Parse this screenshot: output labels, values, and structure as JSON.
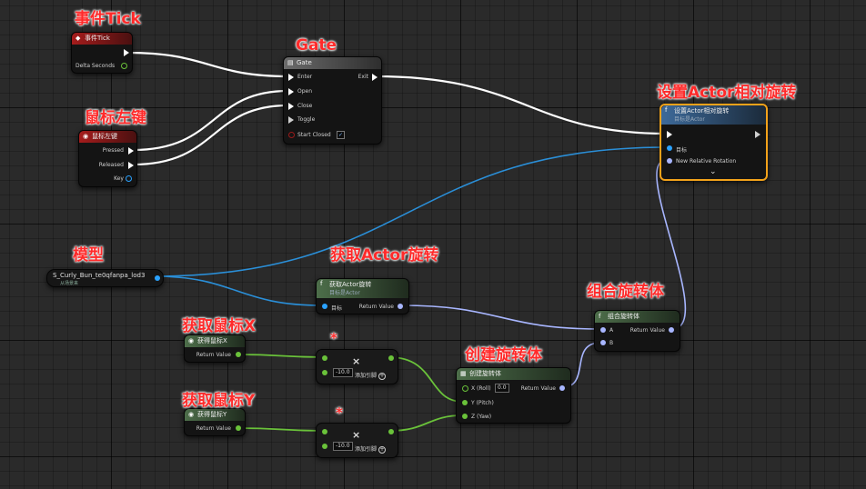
{
  "annotations": {
    "event_tick": "事件Tick",
    "gate": "Gate",
    "mouse_left": "鼠标左键",
    "set_rotation": "设置Actor相对旋转",
    "model": "模型",
    "get_rotation": "获取Actor旋转",
    "combine": "组合旋转体",
    "get_mouse_x": "获取鼠标X",
    "get_mouse_y": "获取鼠标Y",
    "make_rotator": "创建旋转体",
    "mult_star_1": "*",
    "mult_star_2": "*"
  },
  "nodes": {
    "event_tick": {
      "title": "事件Tick",
      "delta": "Delta Seconds"
    },
    "gate": {
      "title": "Gate",
      "enter": "Enter",
      "exit": "Exit",
      "open": "Open",
      "close": "Close",
      "toggle": "Toggle",
      "start_closed": "Start Closed",
      "start_closed_check": "✓"
    },
    "mouse_left": {
      "title": "鼠标左键",
      "pressed": "Pressed",
      "released": "Released",
      "key": "Key"
    },
    "set_rotation": {
      "title": "设置Actor相对旋转",
      "subtitle": "目标是Actor",
      "target": "目标",
      "new_rot": "New Relative Rotation",
      "expand": "⌄"
    },
    "model": {
      "title": "S_Curly_Bun_te0qfanpa_lod3",
      "subtitle": "从场景来"
    },
    "get_rotation": {
      "title": "获取Actor旋转",
      "subtitle": "目标是Actor",
      "target": "目标",
      "ret": "Return Value"
    },
    "combine": {
      "title": "组合旋转体",
      "a": "A",
      "b": "B",
      "ret": "Return Value"
    },
    "get_mouse_x": {
      "title": "获得鼠标X",
      "ret": "Return Value"
    },
    "get_mouse_y": {
      "title": "获得鼠标Y",
      "ret": "Return Value"
    },
    "mult1": {
      "value": "-10.0",
      "add_pin": "添加引脚",
      "symbol": "×"
    },
    "mult2": {
      "value": "-10.0",
      "add_pin": "添加引脚",
      "symbol": "×"
    },
    "make_rotator": {
      "title": "创建旋转体",
      "x": "X (Roll)",
      "x_val": "0.0",
      "y": "Y (Pitch)",
      "z": "Z (Yaw)",
      "ret": "Return Value"
    }
  },
  "icons": {
    "function": "f",
    "event": "◆",
    "mouse": "mouse-icon"
  },
  "colors": {
    "exec": "#ffffff",
    "float": "#6ac23a",
    "rotator": "#a8b6ff",
    "object": "#2aa2ff",
    "annotation": "#ff2a2a",
    "selection": "#f2a21a"
  }
}
